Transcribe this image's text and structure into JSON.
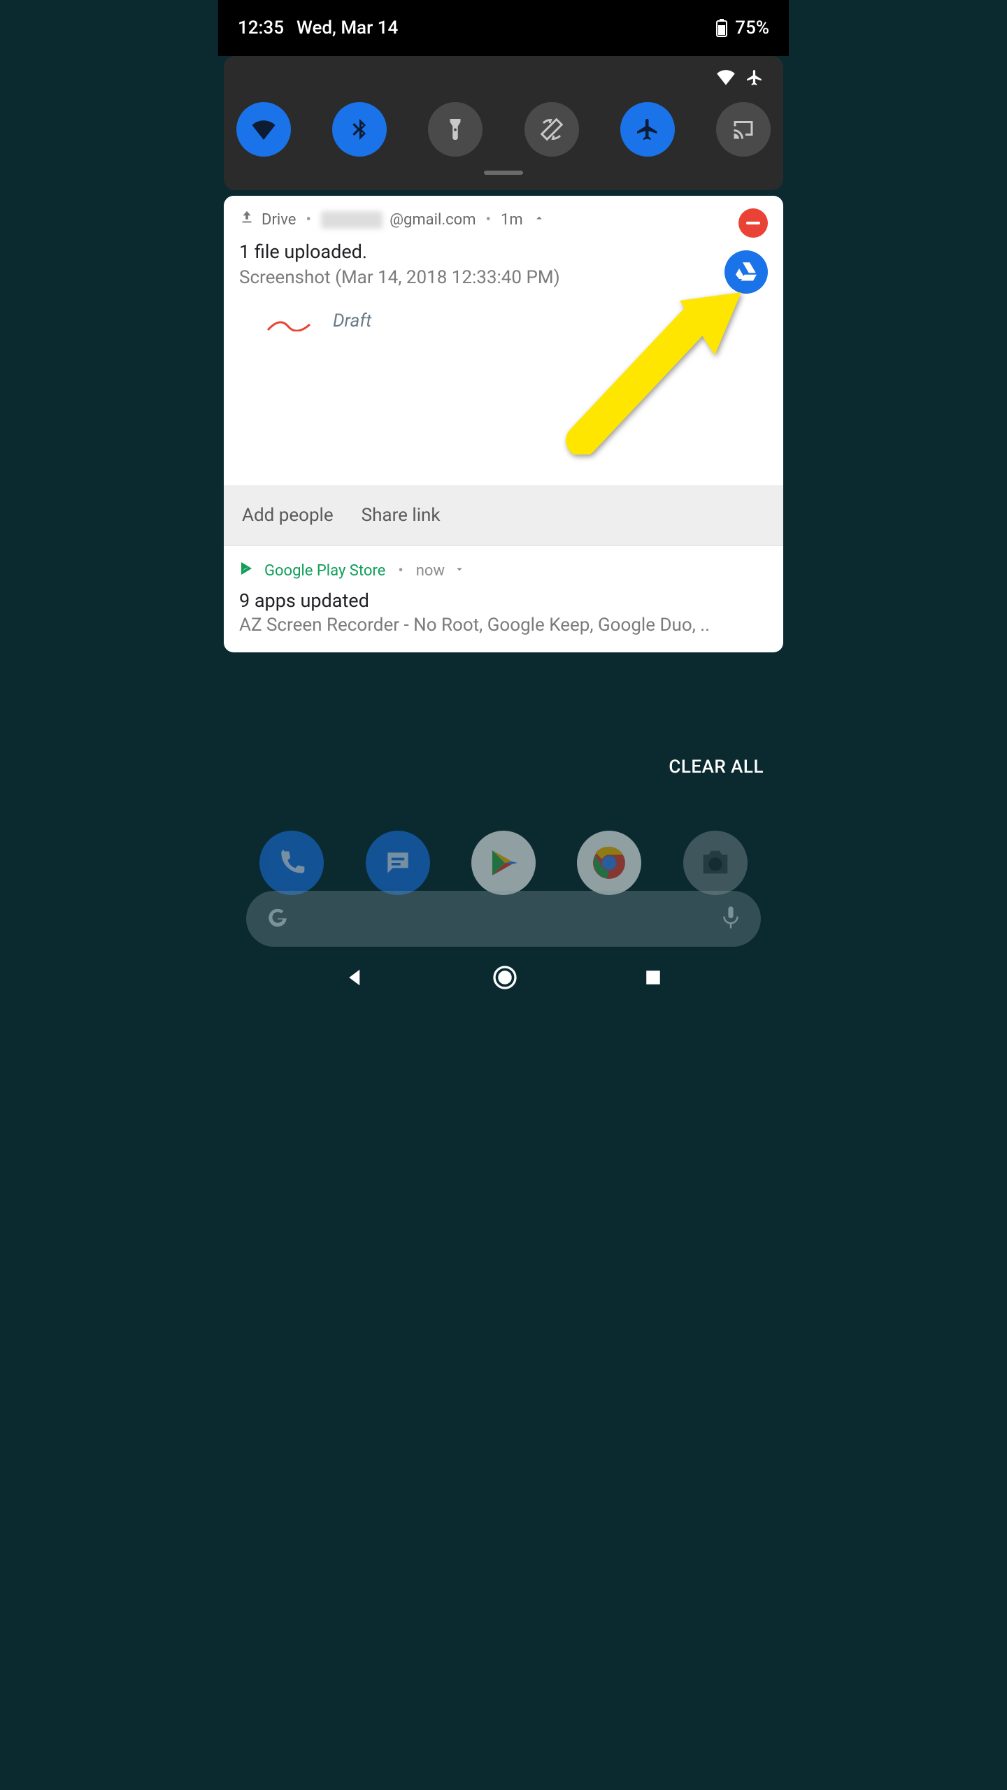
{
  "status": {
    "time": "12:35",
    "date": "Wed, Mar 14",
    "battery": "75%"
  },
  "qs": {
    "tiles": [
      {
        "name": "wifi",
        "on": true
      },
      {
        "name": "bluetooth",
        "on": true
      },
      {
        "name": "flashlight",
        "on": false
      },
      {
        "name": "rotation",
        "on": false
      },
      {
        "name": "airplane",
        "on": true
      },
      {
        "name": "cast",
        "on": false
      }
    ]
  },
  "drive_notif": {
    "app": "Drive",
    "account_prefix_hidden": "xxxxxxx",
    "account_suffix": "@gmail.com",
    "age": "1m",
    "title": "1 file uploaded.",
    "subtitle": "Screenshot (Mar 14, 2018 12:33:40 PM)",
    "thumb_label": "Draft",
    "action1": "Add people",
    "action2": "Share link"
  },
  "ps_notif": {
    "app": "Google Play Store",
    "age": "now",
    "title": "9 apps updated",
    "subtitle": "AZ Screen Recorder - No Root, Google Keep, Google Duo, .."
  },
  "clear_all": "CLEAR ALL"
}
